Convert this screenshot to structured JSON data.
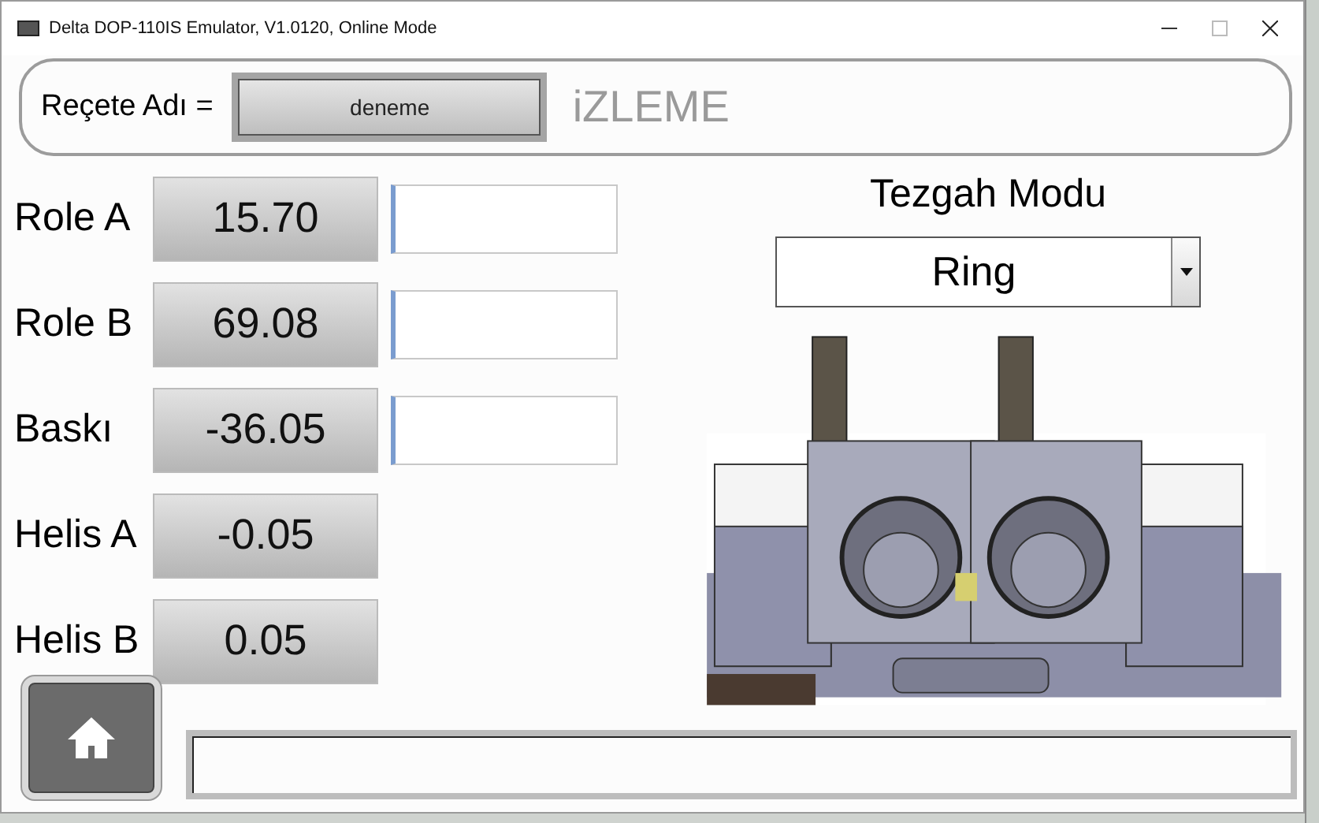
{
  "window": {
    "title": "Delta DOP-110IS Emulator, V1.0120, Online Mode"
  },
  "header": {
    "recipe_label": "Reçete Adı =",
    "recipe_value": "deneme",
    "screen_title": "iZLEME"
  },
  "readings": [
    {
      "label": "Role A",
      "value": "15.70",
      "has_input": true
    },
    {
      "label": "Role B",
      "value": "69.08",
      "has_input": true
    },
    {
      "label": "Baskı",
      "value": "-36.05",
      "has_input": true
    },
    {
      "label": "Helis A",
      "value": "-0.05",
      "has_input": false
    },
    {
      "label": "Helis B",
      "value": "0.05",
      "has_input": false
    }
  ],
  "mode": {
    "title": "Tezgah Modu",
    "value": "Ring"
  }
}
